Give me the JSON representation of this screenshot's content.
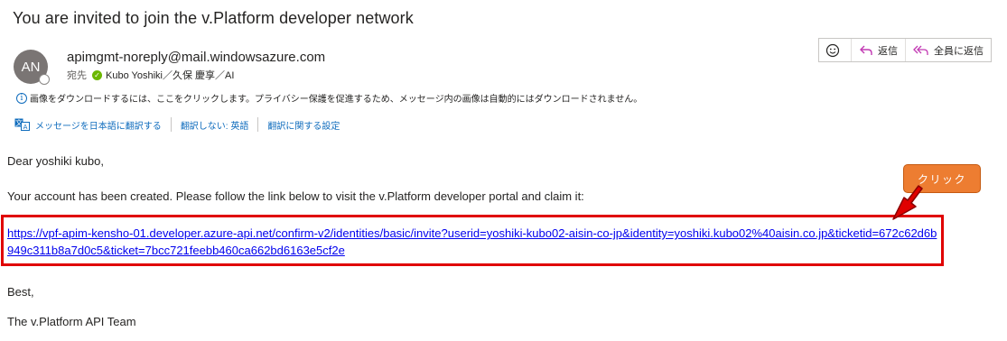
{
  "email": {
    "subject": "You are invited to join the v.Platform developer network",
    "avatar_initials": "AN",
    "sender": "apimgmt-noreply@mail.windowsazure.com",
    "to_label": "宛先",
    "recipient": "Kubo Yoshiki／久保 慶享／AI"
  },
  "actions": {
    "emoji_icon": "smiley-icon",
    "reply_label": "返信",
    "reply_all_label": "全員に返信"
  },
  "info_bar": {
    "icon": "info-icon",
    "text": "画像をダウンロードするには、ここをクリックします。プライバシー保護を促進するため、メッセージ内の画像は自動的にはダウンロードされません。"
  },
  "translate_bar": {
    "icon": "translate-icon",
    "translate_label": "メッセージを日本語に翻訳する",
    "no_translate_label": "翻訳しない: 英語",
    "settings_label": "翻訳に関する設定"
  },
  "body": {
    "greeting": "Dear yoshiki kubo,",
    "intro": "Your account has been created. Please follow the link below to visit the v.Platform developer portal and claim it:",
    "link": "https://vpf-apim-kensho-01.developer.azure-api.net/confirm-v2/identities/basic/invite?userid=yoshiki-kubo02-aisin-co-jp&identity=yoshiki.kubo02%40aisin.co.jp&ticketid=672c62d6b949c311b8a7d0c5&ticket=7bcc721feebb460ca662bd6163e5cf2e",
    "closing": "Best,",
    "signature": "The v.Platform API Team"
  },
  "annotation": {
    "callout_label": "クリック",
    "accent": "#ed7d31",
    "highlight": "#e00000"
  }
}
